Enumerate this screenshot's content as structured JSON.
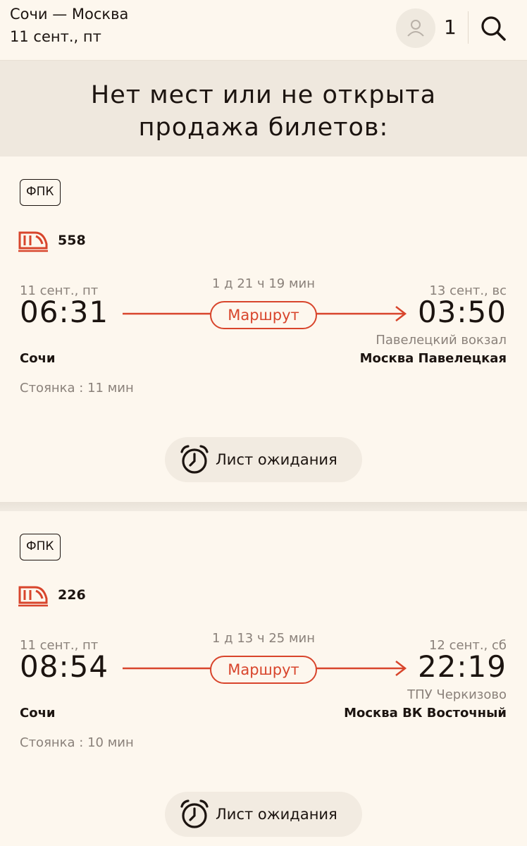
{
  "header": {
    "route": "Сочи — Москва",
    "date": "11 сент., пт",
    "passengers": "1"
  },
  "banner": {
    "line1": "Нет мест или не открыта",
    "line2": "продажа билетов:"
  },
  "trains": [
    {
      "carrier": "ФПК",
      "number": "558",
      "dep_date": "11 сент., пт",
      "dep_time": "06:31",
      "duration": "1 д 21 ч 19 мин",
      "route_label": "Маршрут",
      "arr_date": "13 сент., вс",
      "arr_time": "03:50",
      "arr_station_sub": "Павелецкий вокзал",
      "dep_station": "Сочи",
      "arr_station": "Москва Павелецкая",
      "stop": "Стоянка : 11 мин",
      "wait_label": "Лист ожидания"
    },
    {
      "carrier": "ФПК",
      "number": "226",
      "dep_date": "11 сент., пт",
      "dep_time": "08:54",
      "duration": "1 д 13 ч 25 мин",
      "route_label": "Маршрут",
      "arr_date": "12 сент., сб",
      "arr_time": "22:19",
      "arr_station_sub": "ТПУ Черкизово",
      "dep_station": "Сочи",
      "arr_station": "Москва ВК Восточный",
      "stop": "Стоянка : 10 мин",
      "wait_label": "Лист ожидания"
    }
  ],
  "colors": {
    "accent": "#d8452c",
    "background": "#fdf7ee",
    "muted": "#8a817a"
  },
  "icons": [
    "user-icon",
    "search-icon",
    "train-icon",
    "alarm-clock-icon"
  ]
}
